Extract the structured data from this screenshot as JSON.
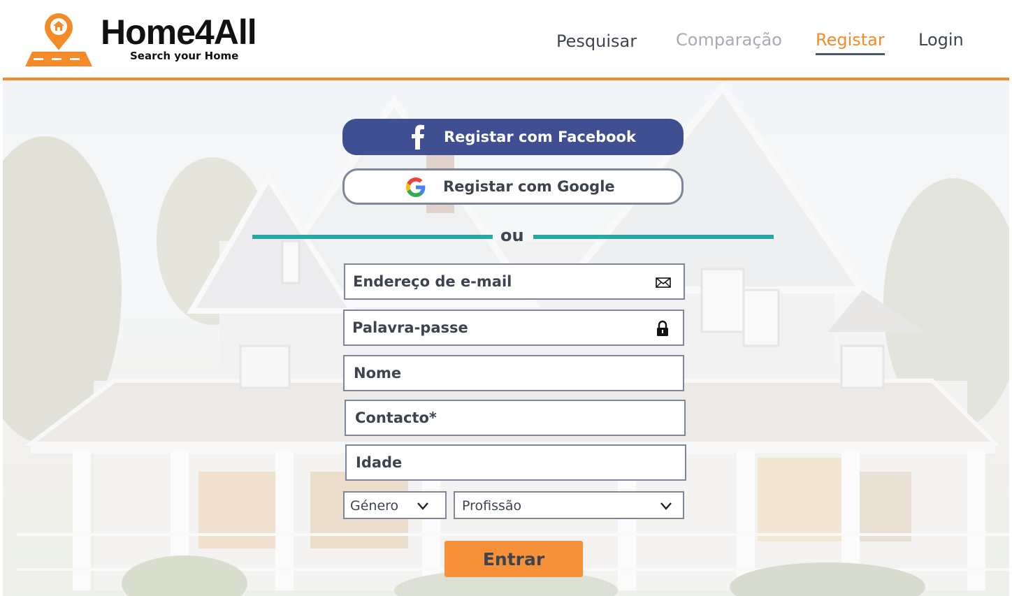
{
  "brand": {
    "name": "Home4All",
    "tagline": "Search your Home"
  },
  "nav": {
    "items": [
      {
        "label": "Pesquisar",
        "state": "default"
      },
      {
        "label": "Comparação",
        "state": "disabled"
      },
      {
        "label": "Registar",
        "state": "active"
      },
      {
        "label": "Login",
        "state": "default"
      }
    ]
  },
  "social": {
    "facebook_label": "Registar com Facebook",
    "google_label": "Registar com Google"
  },
  "divider_text": "ou",
  "form": {
    "email_placeholder": "Endereço de e-mail",
    "password_placeholder": "Palavra-passe",
    "name_placeholder": "Nome",
    "contact_placeholder": "Contacto*",
    "age_placeholder": "Idade",
    "gender_label": "Género",
    "profession_label": "Profissão",
    "submit_label": "Entrar"
  },
  "icons": {
    "logo": "map-pin-house-icon",
    "facebook": "facebook-icon",
    "google": "google-icon",
    "email": "envelope-icon",
    "password": "lock-icon",
    "dropdown": "chevron-down-icon"
  },
  "colors": {
    "accent": "#f58a28",
    "facebook": "#3f4f92",
    "divider": "#27a8a5",
    "text": "#3d4450",
    "border": "#7d8799",
    "submit": "#f6913a"
  }
}
